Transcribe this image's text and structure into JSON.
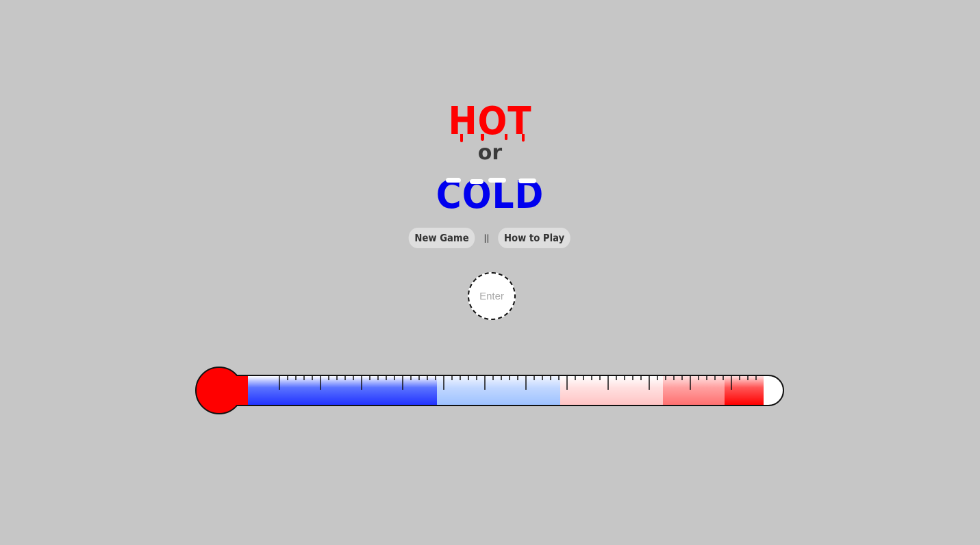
{
  "title": {
    "hot": "HOT",
    "or": "or",
    "cold": "COLD"
  },
  "menu": {
    "new_game_label": "New Game",
    "separator": "||",
    "how_to_play_label": "How to Play"
  },
  "guess": {
    "placeholder": "Enter",
    "value": ""
  },
  "thermometer": {
    "bulb_color": "#ff0000",
    "tube_fill": "#ffffff",
    "segments": [
      {
        "name": "freezing",
        "top_color": "#ffffff",
        "bottom_color": "#2233ff"
      },
      {
        "name": "cold",
        "top_color": "#f2f6ff",
        "bottom_color": "#9ec2ff"
      },
      {
        "name": "warm",
        "top_color": "#ffffff",
        "bottom_color": "#ffc4c4"
      },
      {
        "name": "hot",
        "top_color": "#ffe0e0",
        "bottom_color": "#ff7070"
      },
      {
        "name": "burning",
        "top_color": "#ffdede",
        "bottom_color": "#ff0000"
      }
    ]
  },
  "colors": {
    "background": "#c6c6c6",
    "hot": "#ff0000",
    "cold": "#0000ee",
    "text": "#333333"
  }
}
